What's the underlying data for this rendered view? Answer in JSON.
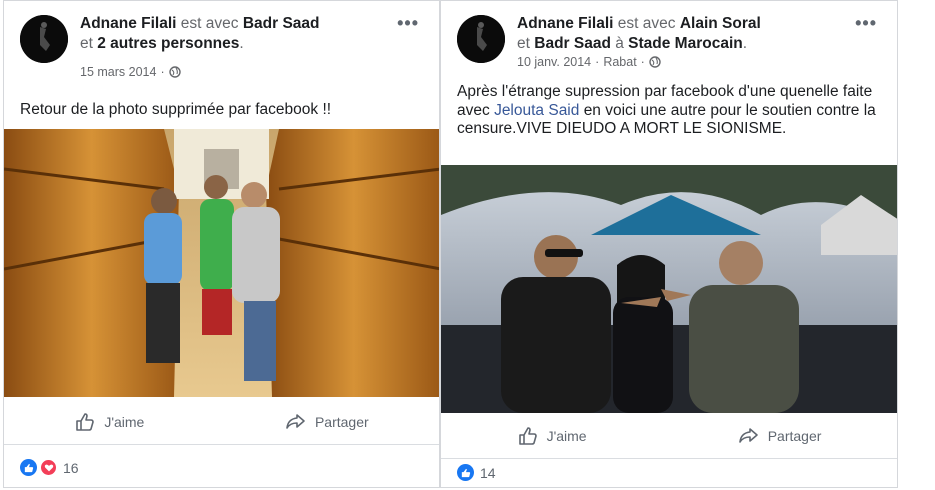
{
  "posts": [
    {
      "author": "Adnane Filali",
      "with_text": "est avec",
      "tagged_primary": "Badr Saad",
      "conj": "et",
      "tagged_others": "2 autres personnes",
      "date": "15 mars 2014",
      "location": "",
      "body": "Retour de la photo supprimée par facebook !!",
      "like_label": "J'aime",
      "share_label": "Partager",
      "reaction_count": "16",
      "more_icon": "more-options-icon"
    },
    {
      "author": "Adnane Filali",
      "with_text": "est avec",
      "tagged_primary": "Alain Soral",
      "conj": "et",
      "tagged_others": "Badr Saad",
      "at_text": "à",
      "place": "Stade Marocain",
      "date": "10 janv. 2014",
      "location": "Rabat",
      "body_pre": "Après l'étrange supression par facebook d'une quenelle faite avec",
      "body_link": "Jelouta Said",
      "body_post": "en voici une autre pour le soutien contre la censure.VIVE DIEUDO A MORT LE SIONISME.",
      "like_label": "J'aime",
      "share_label": "Partager",
      "reaction_count": "14",
      "more_icon": "more-options-icon"
    }
  ],
  "colors": {
    "link": "#385898",
    "meta": "#65676b",
    "like_blue": "#1877f2",
    "love_red": "#f33e58"
  }
}
